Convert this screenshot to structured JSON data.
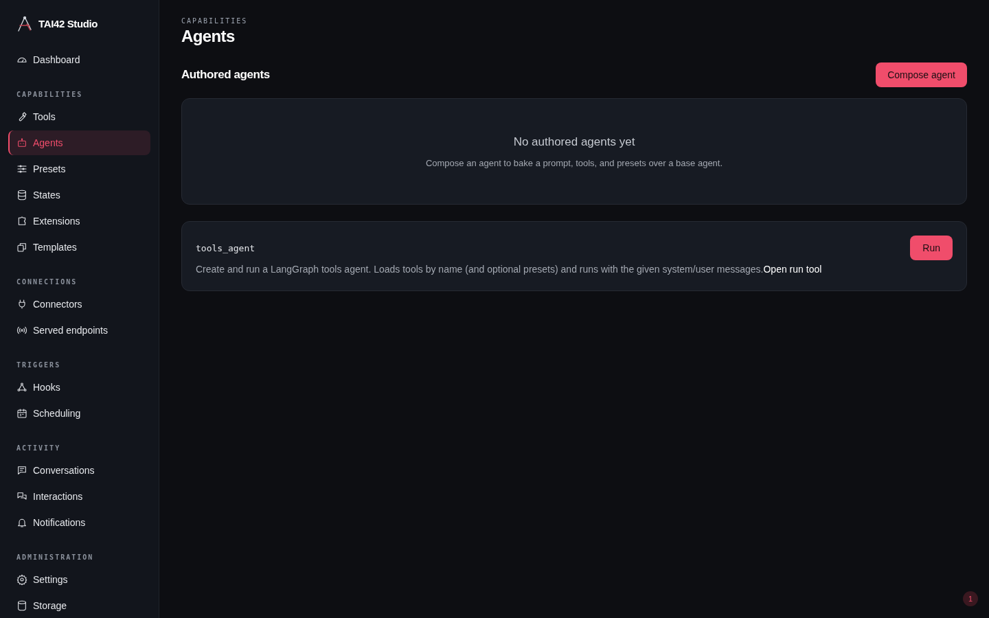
{
  "brand": {
    "name": "TAI42 Studio"
  },
  "sidebar": {
    "top_items": [
      {
        "label": "Dashboard",
        "selected": false
      }
    ],
    "sections": [
      {
        "title": "CAPABILITIES",
        "items": [
          {
            "label": "Tools",
            "selected": false
          },
          {
            "label": "Agents",
            "selected": true
          },
          {
            "label": "Presets",
            "selected": false
          },
          {
            "label": "States",
            "selected": false
          },
          {
            "label": "Extensions",
            "selected": false
          },
          {
            "label": "Templates",
            "selected": false
          }
        ]
      },
      {
        "title": "CONNECTIONS",
        "items": [
          {
            "label": "Connectors",
            "selected": false
          },
          {
            "label": "Served endpoints",
            "selected": false
          }
        ]
      },
      {
        "title": "TRIGGERS",
        "items": [
          {
            "label": "Hooks",
            "selected": false
          },
          {
            "label": "Scheduling",
            "selected": false
          }
        ]
      },
      {
        "title": "ACTIVITY",
        "items": [
          {
            "label": "Conversations",
            "selected": false
          },
          {
            "label": "Interactions",
            "selected": false
          },
          {
            "label": "Notifications",
            "selected": false
          }
        ]
      },
      {
        "title": "ADMINISTRATION",
        "items": [
          {
            "label": "Settings",
            "selected": false
          },
          {
            "label": "Storage",
            "selected": false
          }
        ]
      }
    ]
  },
  "page": {
    "eyebrow": "CAPABILITIES",
    "title": "Agents"
  },
  "authored": {
    "heading": "Authored agents",
    "button": "Compose agent",
    "empty_title": "No authored agents yet",
    "empty_text": "Compose an agent to bake a prompt, tools, and presets over a base agent."
  },
  "agents": [
    {
      "name": "tools_agent",
      "description": "Create and run a LangGraph tools agent. Loads tools by name (and optional presets) and runs with the given system/user messages.",
      "link": "Open run tool",
      "button": "Run"
    }
  ],
  "badge": "1"
}
